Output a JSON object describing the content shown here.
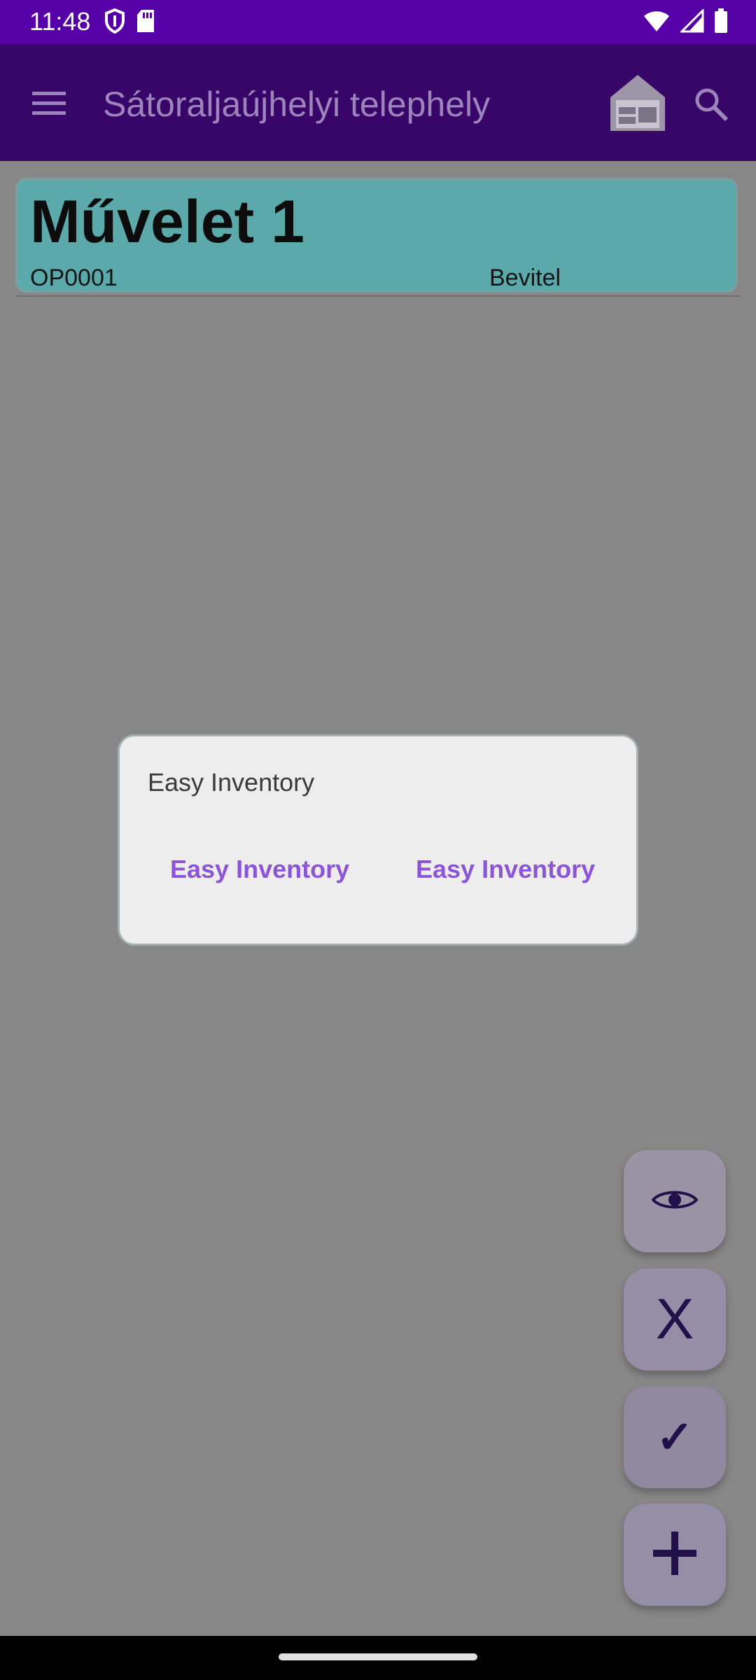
{
  "status_bar": {
    "time": "11:48",
    "icons": [
      "shield-icon",
      "sd-card-icon",
      "wifi-icon",
      "signal-icon",
      "battery-icon"
    ]
  },
  "app_bar": {
    "title": "Sátoraljaújhelyi telephely",
    "icons": [
      "menu-icon",
      "warehouse-icon",
      "search-icon"
    ]
  },
  "operation_card": {
    "title": "Művelet 1",
    "code": "OP0001",
    "type": "Bevitel"
  },
  "dialog": {
    "title": "Easy Inventory",
    "button_1": "Easy Inventory",
    "button_2": "Easy Inventory"
  },
  "fabs": {
    "cancel_label": "X",
    "confirm_label": "✓",
    "icons": [
      "eye-icon",
      "plus-icon"
    ]
  },
  "colors": {
    "status_bar": "#5600a8",
    "app_bar": "#380568",
    "card": "#5ba9aa",
    "dialog_button": "#8b55d6"
  }
}
